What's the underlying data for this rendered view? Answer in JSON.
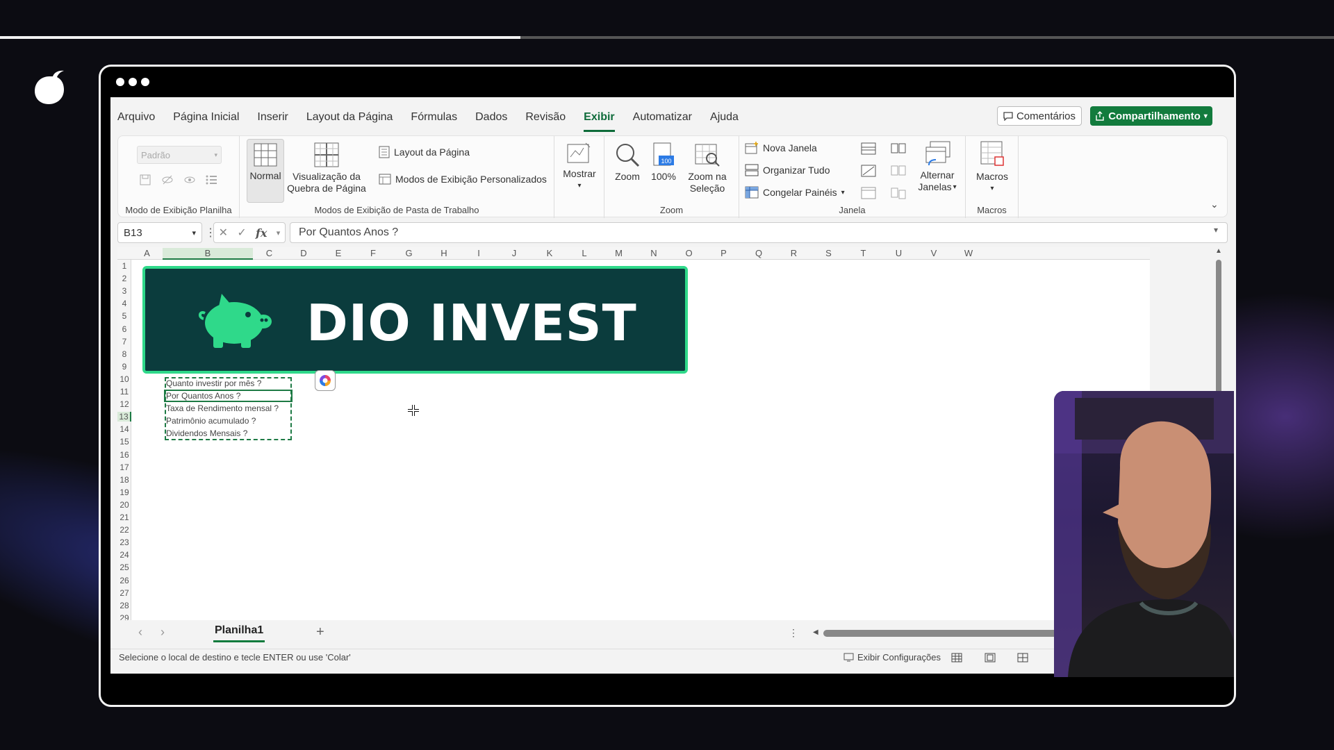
{
  "video": {
    "progress_fraction": 0.39
  },
  "window_controls": [
    "dot",
    "dot",
    "dot"
  ],
  "menu": {
    "items": [
      "Arquivo",
      "Página Inicial",
      "Inserir",
      "Layout da Página",
      "Fórmulas",
      "Dados",
      "Revisão",
      "Exibir",
      "Automatizar",
      "Ajuda"
    ],
    "active": "Exibir",
    "comments_label": "Comentários",
    "share_label": "Compartilhamento"
  },
  "ribbon": {
    "sheet_view": {
      "select_placeholder": "Padrão",
      "group_label": "Modo de Exibição Planilha"
    },
    "workbook_views": {
      "normal": "Normal",
      "page_break_line1": "Visualização da",
      "page_break_line2": "Quebra de Página",
      "page_layout": "Layout da Página",
      "custom_views": "Modos de Exibição Personalizados",
      "group_label": "Modos de Exibição de Pasta de Trabalho"
    },
    "show": {
      "label": "Mostrar"
    },
    "zoom": {
      "zoom": "Zoom",
      "hundred": "100%",
      "selection_line1": "Zoom na",
      "selection_line2": "Seleção",
      "group_label": "Zoom"
    },
    "window": {
      "new_window": "Nova Janela",
      "arrange_all": "Organizar Tudo",
      "freeze_panes": "Congelar Painéis",
      "switch_line1": "Alternar",
      "switch_line2": "Janelas",
      "group_label": "Janela"
    },
    "macros": {
      "label": "Macros",
      "group_label": "Macros"
    }
  },
  "formula_bar": {
    "name_box": "B13",
    "fx": "fx",
    "formula": "Por Quantos Anos ?"
  },
  "columns": [
    "A",
    "B",
    "C",
    "D",
    "E",
    "F",
    "G",
    "H",
    "I",
    "J",
    "K",
    "L",
    "M",
    "N",
    "O",
    "P",
    "Q",
    "R",
    "S",
    "T",
    "U",
    "V",
    "W"
  ],
  "rows": [
    "1",
    "2",
    "3",
    "4",
    "5",
    "6",
    "7",
    "8",
    "9",
    "10",
    "11",
    "12",
    "13",
    "14",
    "15",
    "16",
    "17",
    "18",
    "19",
    "20",
    "21",
    "22",
    "23",
    "24",
    "25",
    "26",
    "27",
    "28",
    "29"
  ],
  "banner": {
    "title": "DIO INVEST",
    "bg_color": "#0b3c3d",
    "border_color": "#2fd98a"
  },
  "cells": [
    {
      "ref": "B12",
      "text": "Quanto investir por mês ?"
    },
    {
      "ref": "B13",
      "text": "Por Quantos Anos ?"
    },
    {
      "ref": "B14",
      "text": "Taxa de Rendimento mensal ?"
    },
    {
      "ref": "B15",
      "text": "Patrimônio acumulado ?"
    },
    {
      "ref": "B16",
      "text": "Dividendos Mensais ?"
    }
  ],
  "sheet_tabs": {
    "active": "Planilha1"
  },
  "status": {
    "message": "Selecione o local de destino e tecle ENTER ou use 'Colar'",
    "display_settings": "Exibir Configurações"
  },
  "colors": {
    "accent": "#127b3d",
    "frame": "#f4f4f4"
  }
}
